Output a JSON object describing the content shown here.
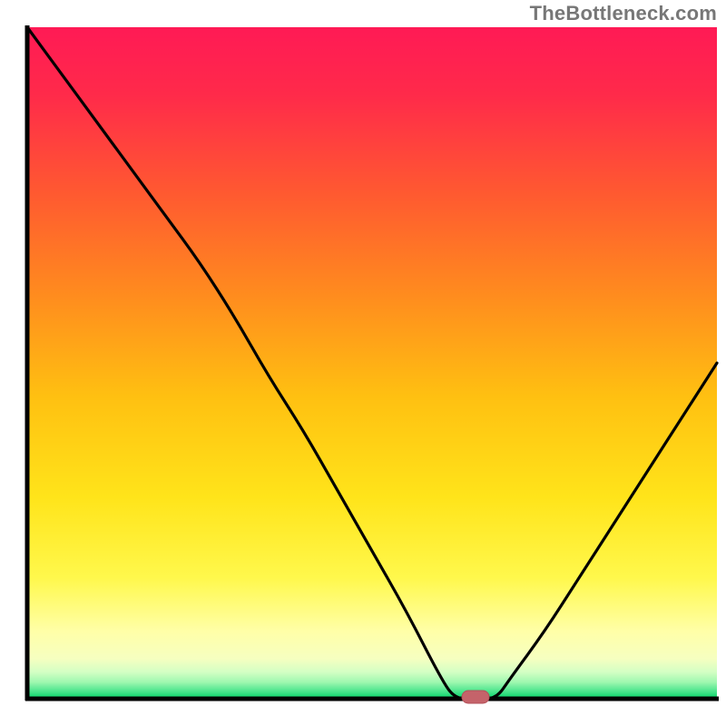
{
  "watermark": "TheBottleneck.com",
  "colors": {
    "gradient_top": "#ff1a4d",
    "gradient_mid1": "#ff6a2a",
    "gradient_mid2": "#ffc212",
    "gradient_mid3": "#ffe637",
    "gradient_low_yellow": "#ffffaa",
    "gradient_green_light": "#90f090",
    "gradient_green": "#00d45a",
    "curve_stroke": "#000000",
    "axes_stroke": "#000000",
    "marker_fill": "#c86064"
  },
  "chart_data": {
    "type": "line",
    "title": "",
    "xlabel": "",
    "ylabel": "",
    "xlim": [
      0,
      100
    ],
    "ylim": [
      0,
      100
    ],
    "x": [
      0,
      5,
      10,
      15,
      20,
      25,
      30,
      35,
      40,
      45,
      50,
      55,
      60,
      62,
      65,
      68,
      70,
      75,
      80,
      85,
      90,
      95,
      100
    ],
    "values": [
      100,
      93,
      86,
      79,
      72,
      65,
      57,
      48,
      40,
      31,
      22,
      13,
      3,
      0,
      0,
      0,
      3,
      10,
      18,
      26,
      34,
      42,
      50
    ],
    "note": "V-shaped bottleneck curve; y is mismatch %, optimum at x≈62–68",
    "optimum_marker": {
      "x": 65,
      "y": 0,
      "label": ""
    }
  }
}
